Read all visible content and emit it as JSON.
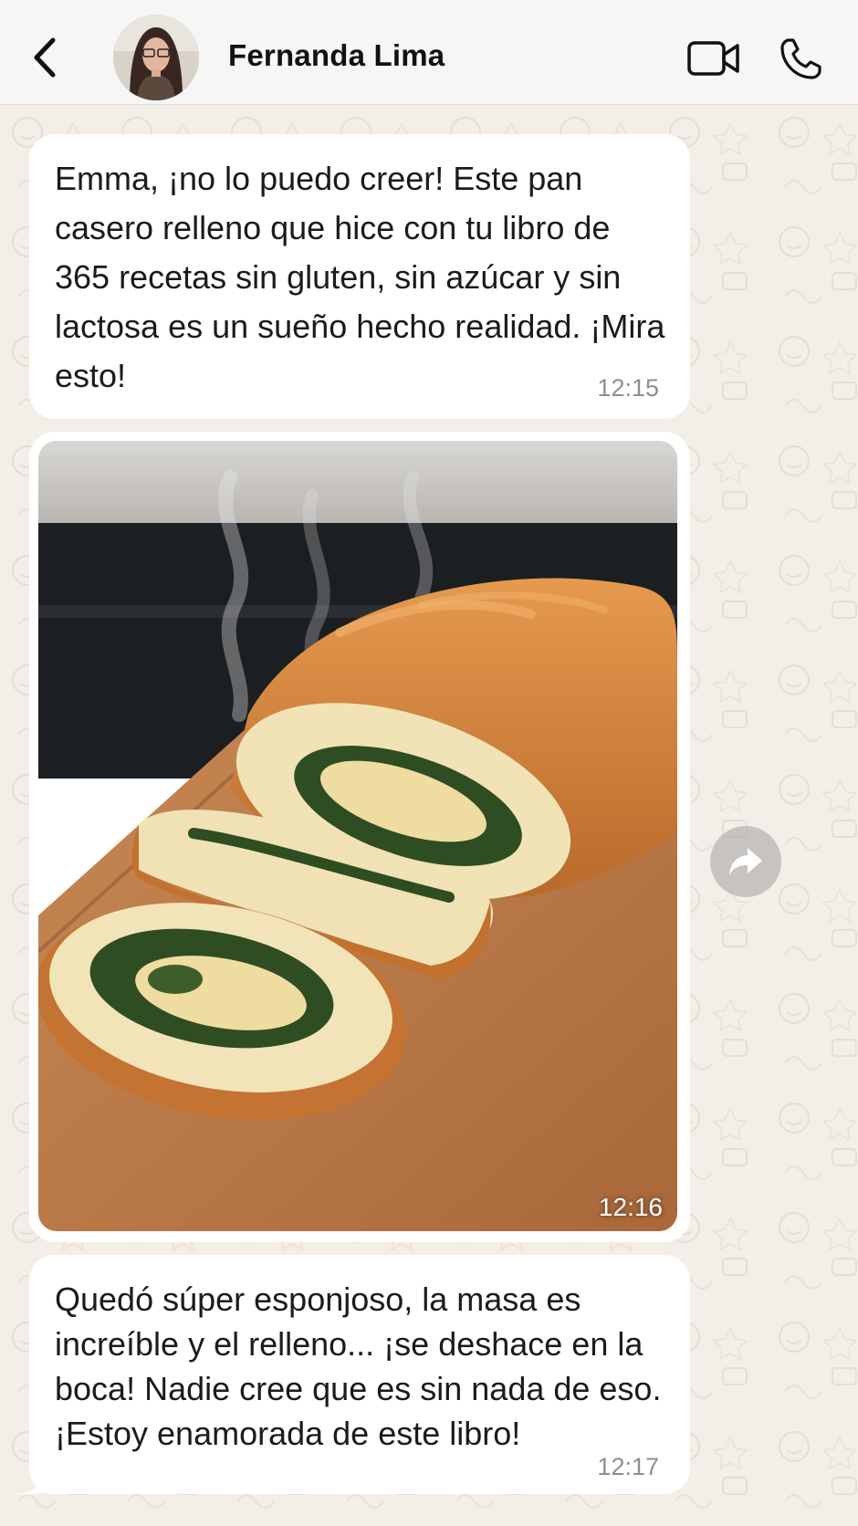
{
  "header": {
    "contact_name": "Fernanda Lima",
    "icons": [
      "back-chevron-icon",
      "video-call-icon",
      "phone-call-icon"
    ]
  },
  "messages": [
    {
      "type": "text",
      "text": "Emma, ¡no lo puedo creer! Este pan casero relleno que hice con tu libro de 365 recetas sin gluten, sin azúcar y sin lactosa es un sueño hecho realidad. ¡Mira esto!",
      "time": "12:15"
    },
    {
      "type": "image",
      "image_subject": "stuffed-bread-photo",
      "time": "12:16"
    },
    {
      "type": "text",
      "text": "Quedó súper esponjoso, la masa es increíble y el relleno... ¡se deshace en la boca! Nadie cree que es sin nada de eso. ¡Estoy enamorada de este libro!",
      "time": "12:17"
    }
  ],
  "colors": {
    "chat_background": "#f4eee8",
    "bubble": "#ffffff",
    "header": "#f6f6f6"
  }
}
